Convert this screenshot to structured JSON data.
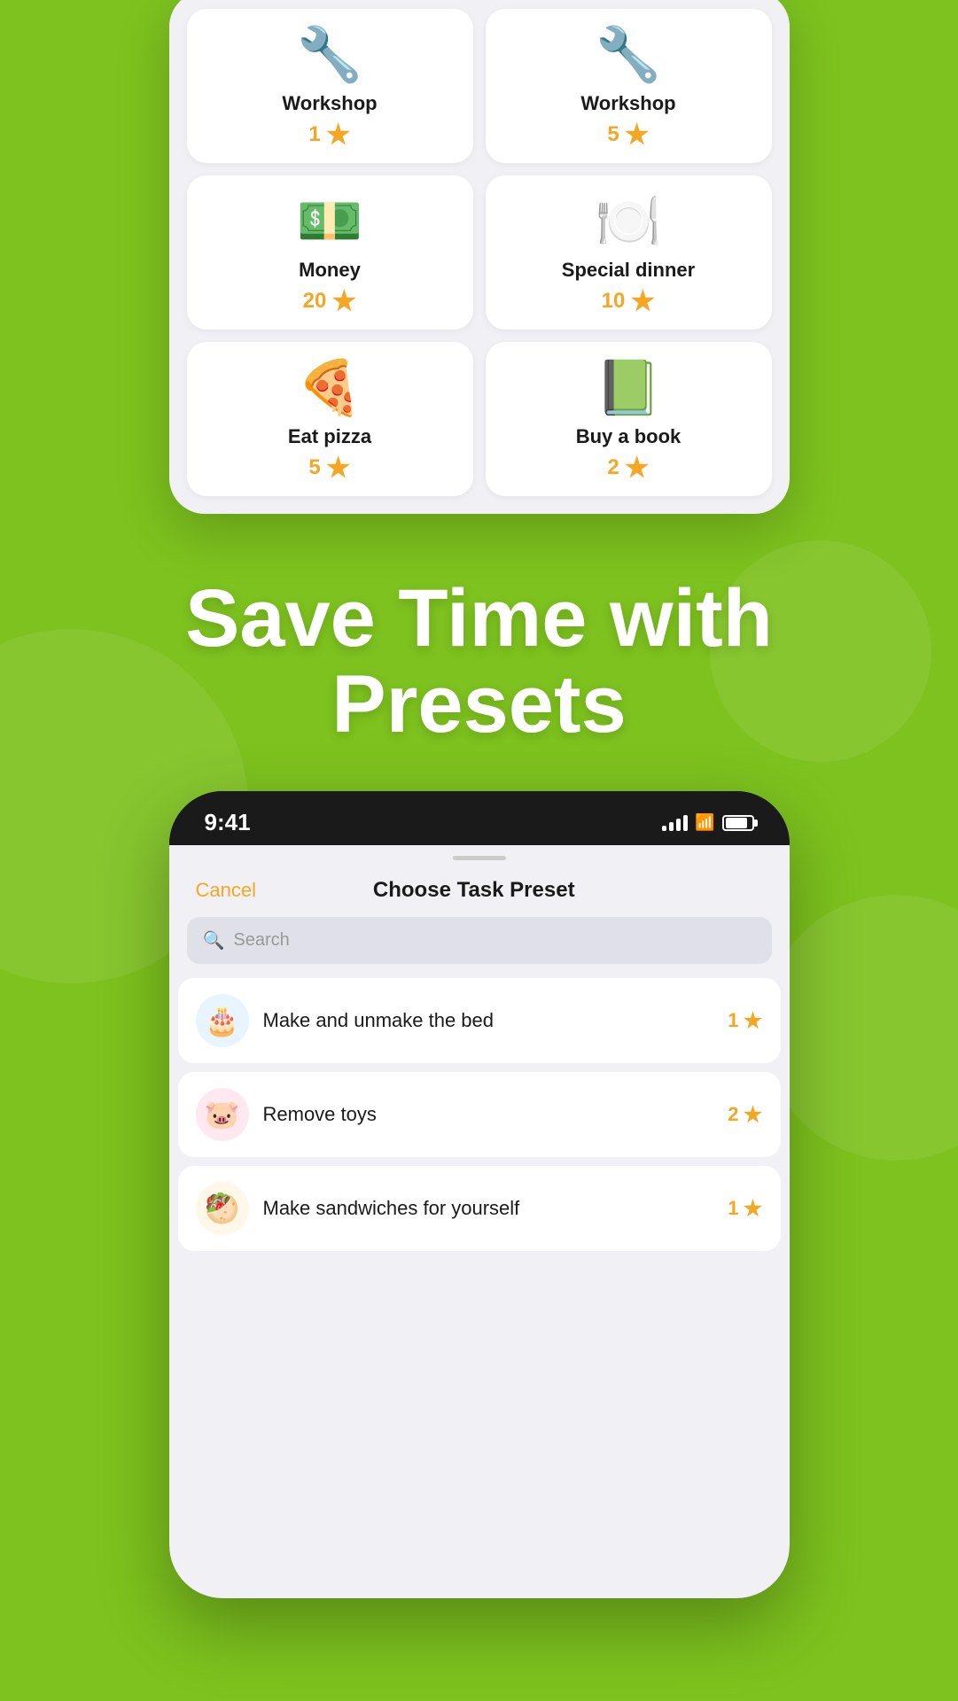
{
  "topPhone": {
    "cards": [
      {
        "id": "workshop1",
        "icon": "🔧",
        "name": "Workshop",
        "points": "1"
      },
      {
        "id": "workshop5",
        "icon": "🔧",
        "name": "Workshop",
        "points": "5"
      },
      {
        "id": "money20",
        "icon": "💵",
        "name": "Money",
        "points": "20"
      },
      {
        "id": "specialdinner10",
        "icon": "🍽️",
        "name": "Special dinner",
        "points": "10"
      },
      {
        "id": "eatpizza5",
        "icon": "🍕",
        "name": "Eat pizza",
        "points": "5"
      },
      {
        "id": "buyabook2",
        "icon": "📗",
        "name": "Buy a book",
        "points": "2"
      }
    ]
  },
  "headline": {
    "line1": "Save Time with",
    "line2": "Presets"
  },
  "bottomPhone": {
    "statusBar": {
      "time": "9:41"
    },
    "sheet": {
      "cancelLabel": "Cancel",
      "title": "Choose Task Preset",
      "searchPlaceholder": "Search"
    },
    "tasks": [
      {
        "id": "make-bed",
        "icon": "🎂",
        "iconBg": "blue-bg",
        "name": "Make and unmake the bed",
        "points": "1"
      },
      {
        "id": "remove-toys",
        "icon": "🐷",
        "iconBg": "pink-bg",
        "name": "Remove toys",
        "points": "2"
      },
      {
        "id": "make-sandwiches",
        "icon": "🥙",
        "iconBg": "yellow-bg",
        "name": "Make sandwiches for yourself",
        "points": "1"
      }
    ]
  }
}
